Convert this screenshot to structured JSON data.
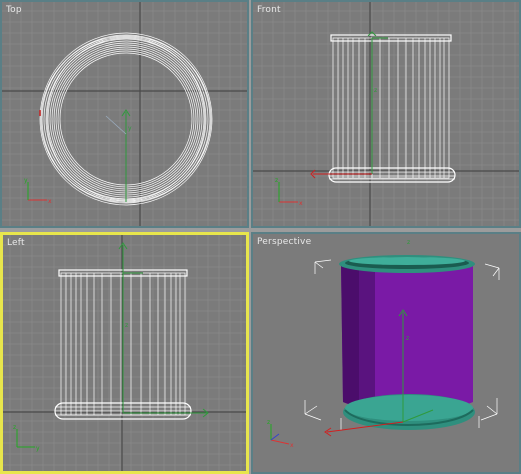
{
  "viewports": {
    "top": {
      "label": "Top"
    },
    "front": {
      "label": "Front"
    },
    "left": {
      "label": "Left"
    },
    "perspective": {
      "label": "Perspective"
    }
  },
  "colors": {
    "viewport_bg": "#7b7b7b",
    "grid_minor": "#8e8e8e",
    "grid_major": "#4a4a4a",
    "active_border": "#e8e64c",
    "inactive_border": "#5a7f86",
    "wireframe": "#ffffff",
    "object_body": "#7a1aa6",
    "object_rim": "#2f8f7e"
  },
  "icons": {
    "axis_tripod": "axis-tripod-icon",
    "transform_gizmo": "move-gizmo-icon"
  }
}
